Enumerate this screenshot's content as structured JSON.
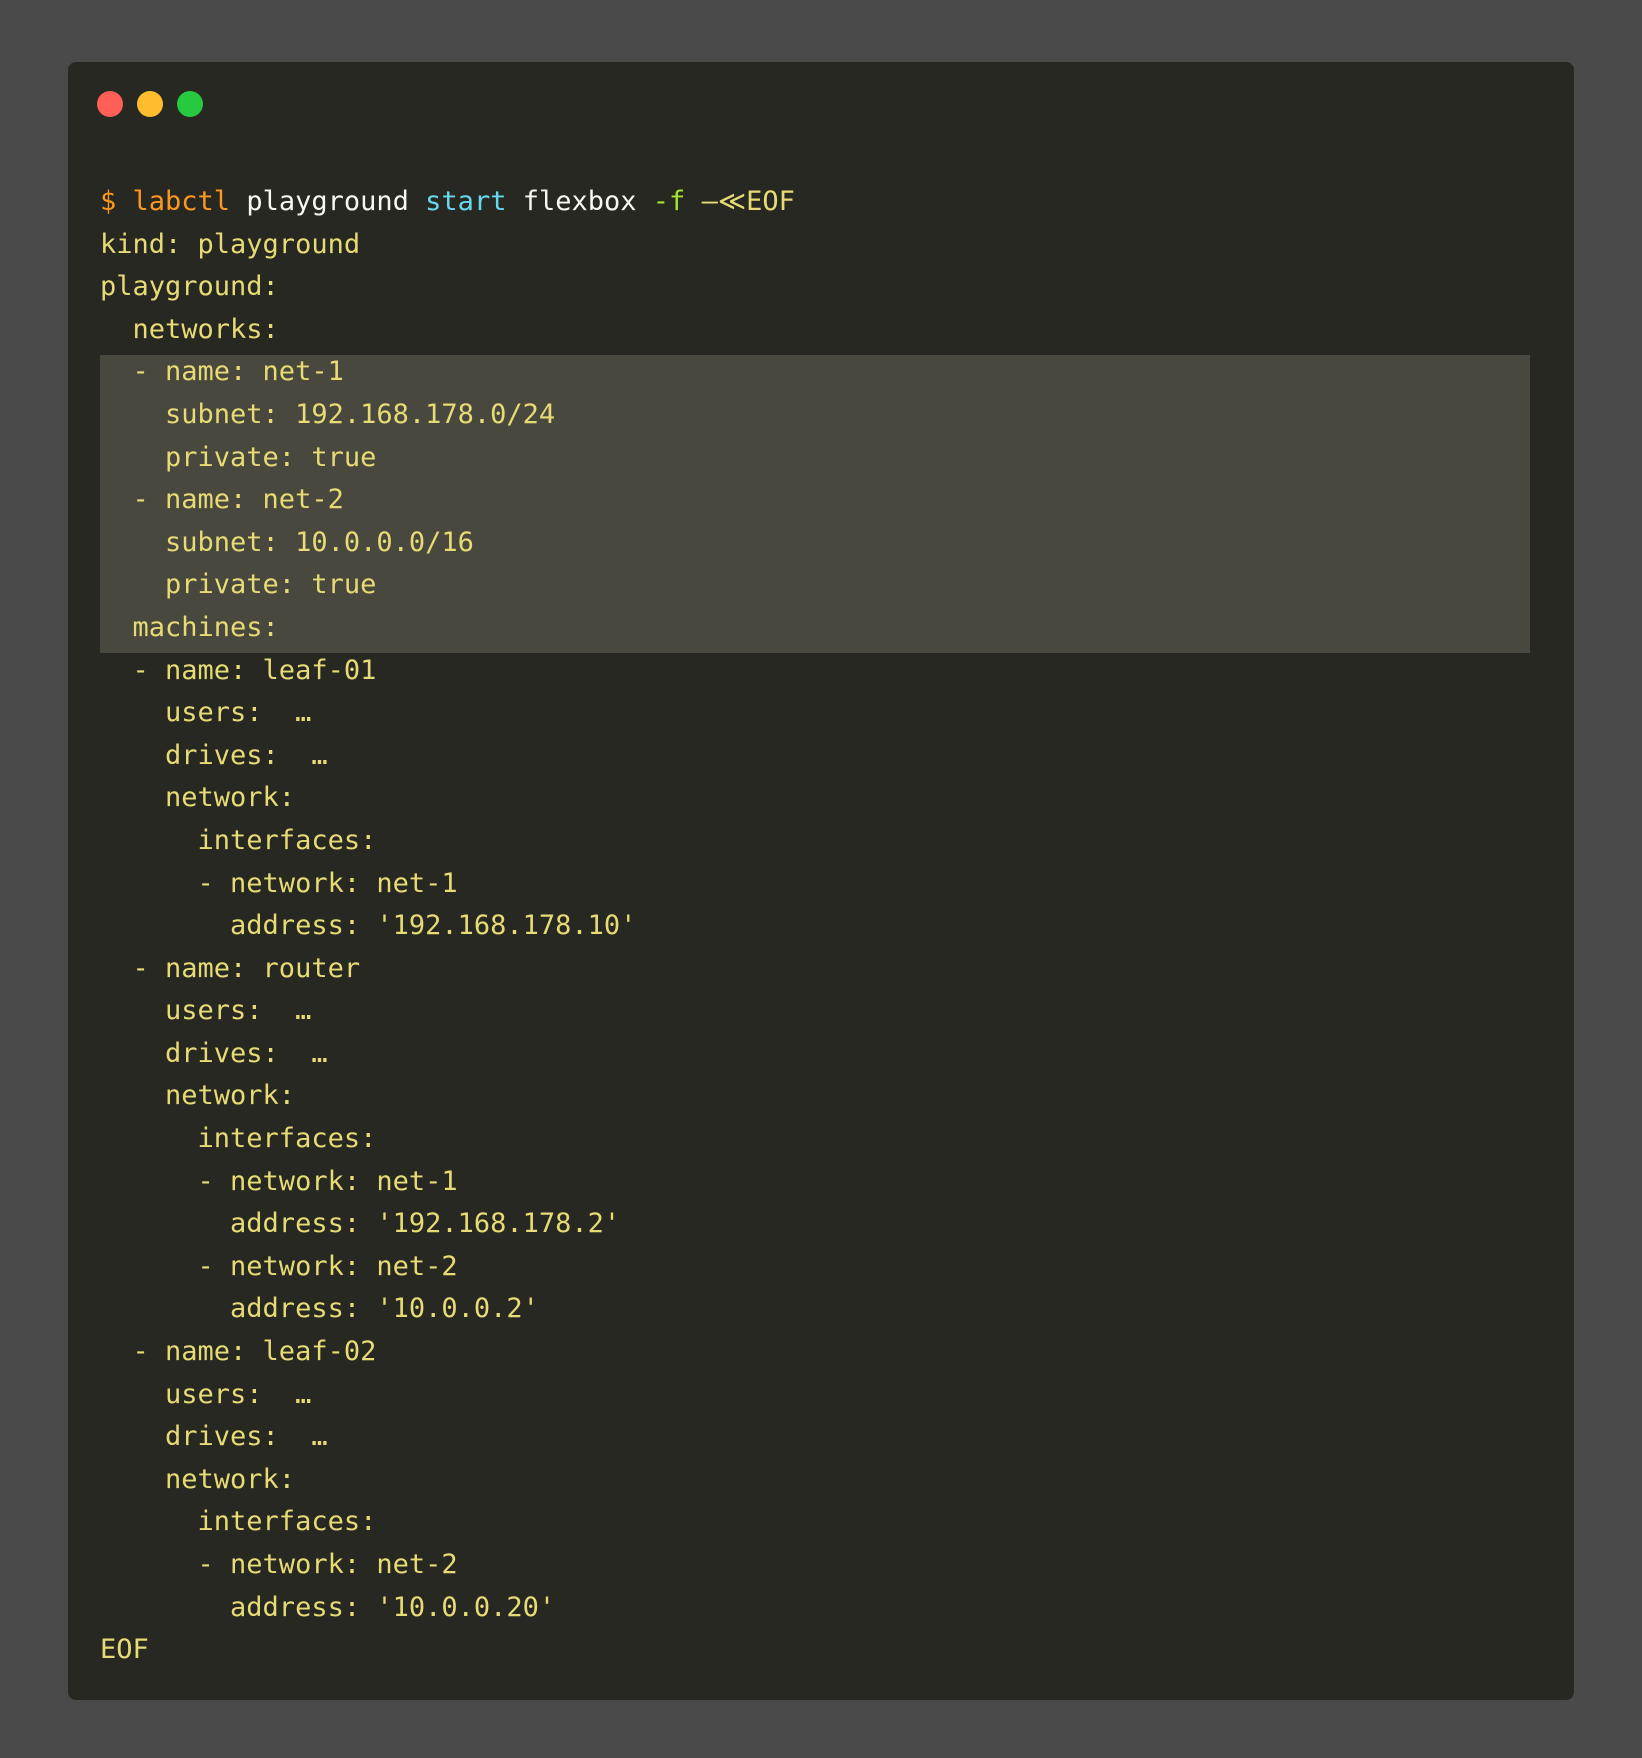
{
  "command": {
    "prompt": "$",
    "program": "labctl",
    "arg1": "playground",
    "subcommand": "start",
    "arg2": "flexbox",
    "flag": "-f",
    "heredoc": "—≪EOF"
  },
  "yaml_lines": [
    "kind: playground",
    "playground:",
    "  networks:",
    "  - name: net-1",
    "    subnet: 192.168.178.0/24",
    "    private: true",
    "  - name: net-2",
    "    subnet: 10.0.0.0/16",
    "    private: true",
    "  machines:",
    "  - name: leaf-01",
    "    users:  …",
    "    drives:  …",
    "    network:",
    "      interfaces:",
    "      - network: net-1",
    "        address: '192.168.178.10'",
    "  - name: router",
    "    users:  …",
    "    drives:  …",
    "    network:",
    "      interfaces:",
    "      - network: net-1",
    "        address: '192.168.178.2'",
    "      - network: net-2",
    "        address: '10.0.0.2'",
    "  - name: leaf-02",
    "    users:  …",
    "    drives:  …",
    "    network:",
    "      interfaces:",
    "      - network: net-2",
    "        address: '10.0.0.20'",
    "EOF"
  ],
  "colors": {
    "background": "#4a4a4a",
    "terminal": "#272822",
    "highlight": "#49483e",
    "yaml_text": "#e6db74",
    "command": "#fd971f",
    "subcommand": "#66d9ef",
    "flag": "#a6e22e"
  }
}
